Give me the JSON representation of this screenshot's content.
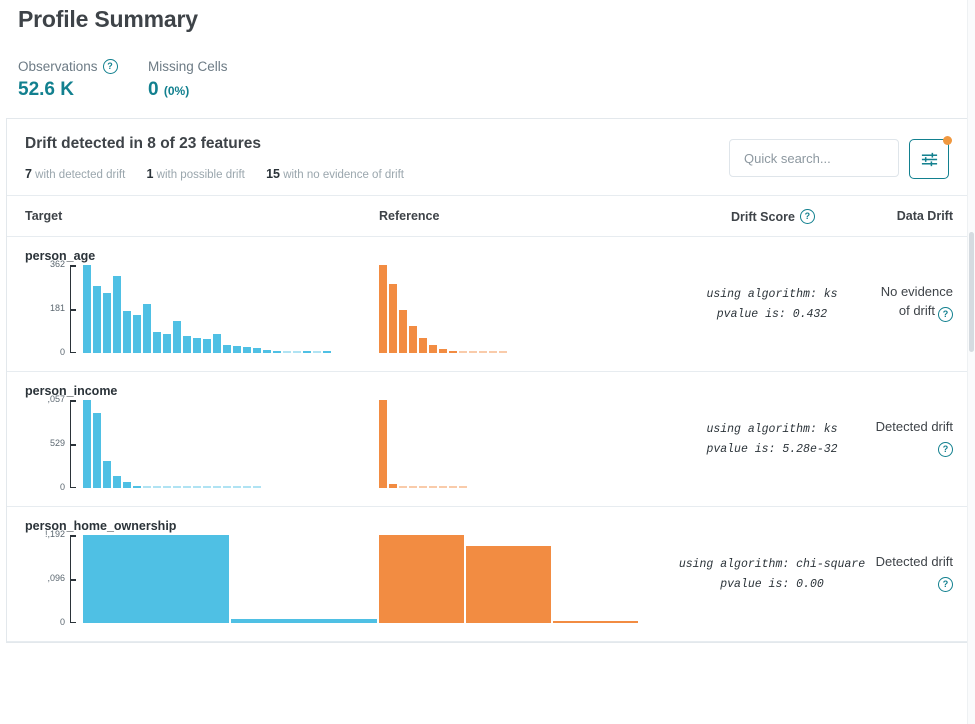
{
  "header": {
    "title": "Profile Summary",
    "metrics": [
      {
        "label": "Observations",
        "value": "52.6 K",
        "pct": "",
        "has_hint": true
      },
      {
        "label": "Missing Cells",
        "value": "0",
        "pct": "(0%)",
        "has_hint": false
      }
    ]
  },
  "drift_panel": {
    "title": "Drift detected in 8 of 23 features",
    "counts": [
      {
        "num": "7",
        "text": "with detected drift"
      },
      {
        "num": "1",
        "text": "with possible drift"
      },
      {
        "num": "15",
        "text": "with no evidence of drift"
      }
    ],
    "search_placeholder": "Quick search...",
    "search_value": "",
    "search_icon": "search-icon",
    "filter_icon": "sliders-icon",
    "filter_has_badge": true
  },
  "table": {
    "columns": [
      "Target",
      "Reference",
      "Drift Score",
      "Data Drift"
    ],
    "rows": [
      {
        "feature": "person_age",
        "algorithm": "using algorithm: ks",
        "pvalue": "pvalue is: 0.432",
        "verdict": "No evidence of drift",
        "target_axis": [
          "362",
          "181",
          "0"
        ],
        "reference_axis": [],
        "chart_data": {
          "type": "bar",
          "title": "person_age",
          "ylim": [
            0,
            362
          ],
          "ylabel": "",
          "xlabel": "",
          "grid": false,
          "legend": "none",
          "series": [
            {
              "name": "Target",
              "color": "#4FC0E4",
              "values": [
                362,
                275,
                247,
                316,
                171,
                155,
                202,
                88,
                79,
                130,
                70,
                62,
                56,
                77,
                33,
                27,
                24,
                19,
                14,
                10,
                6,
                4,
                9,
                3,
                8
              ]
            },
            {
              "name": "Reference",
              "color": "#F28C42",
              "values": [
                362,
                285,
                175,
                112,
                62,
                32,
                18,
                10,
                5,
                3,
                2,
                1,
                1
              ]
            }
          ]
        }
      },
      {
        "feature": "person_income",
        "algorithm": "using algorithm: ks",
        "pvalue": "pvalue is: 5.28e-32",
        "verdict": "Detected drift",
        "target_axis": [
          ",057",
          "529",
          "0"
        ],
        "reference_axis": [],
        "chart_data": {
          "type": "bar",
          "title": "person_income",
          "ylim": [
            0,
            1057
          ],
          "ylabel": "",
          "xlabel": "",
          "grid": false,
          "legend": "none",
          "series": [
            {
              "name": "Target",
              "color": "#4FC0E4",
              "values": [
                1057,
                905,
                320,
                140,
                70,
                28,
                14,
                8,
                5,
                3,
                2,
                1,
                1,
                1,
                1,
                1,
                1,
                1
              ]
            },
            {
              "name": "Reference",
              "color": "#F28C42",
              "values": [
                1057,
                45,
                14,
                6,
                3,
                2,
                1,
                1,
                1
              ]
            }
          ]
        }
      },
      {
        "feature": "person_home_ownership",
        "algorithm": "using algorithm: chi-square",
        "pvalue": "pvalue is: 0.00",
        "verdict": "Detected drift",
        "target_axis": [
          "!,192",
          ",096",
          "0"
        ],
        "reference_axis": [],
        "chart_data": {
          "type": "bar",
          "title": "person_home_ownership",
          "ylim": [
            0,
            2192
          ],
          "ylabel": "",
          "xlabel": "",
          "grid": false,
          "legend": "none",
          "series": [
            {
              "name": "Target",
              "color": "#4FC0E4",
              "values": [
                2192,
                95
              ]
            },
            {
              "name": "Reference",
              "color": "#F28C42",
              "values": [
                2192,
                1930,
                60
              ]
            }
          ]
        }
      }
    ]
  },
  "colors": {
    "target_blue": "#4FC0E4",
    "reference_orange": "#F28C42",
    "accent_teal": "#12808f",
    "badge_orange": "#f0983f"
  }
}
